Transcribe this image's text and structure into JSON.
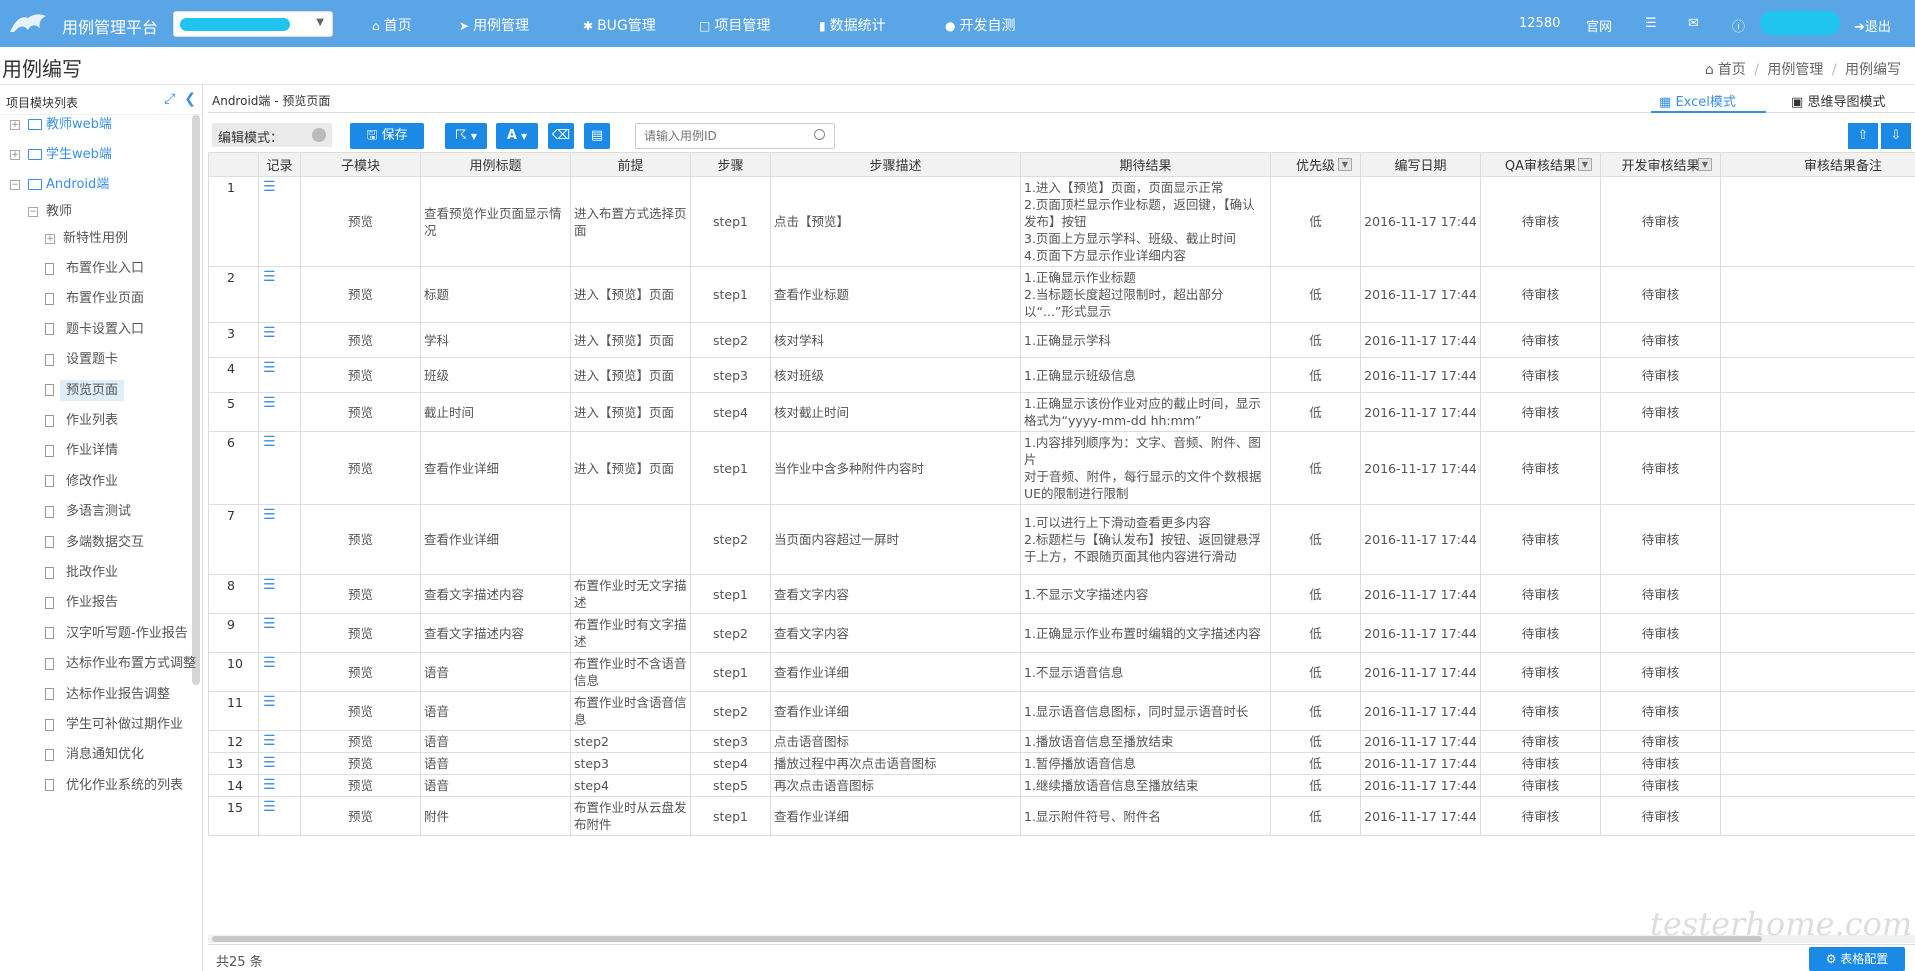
{
  "topnav": {
    "app_title": "用例管理平台",
    "items": [
      {
        "label": "首页",
        "icon": "home-icon"
      },
      {
        "label": "用例管理",
        "icon": "case-icon"
      },
      {
        "label": "BUG管理",
        "icon": "bug-icon"
      },
      {
        "label": "项目管理",
        "icon": "folder-icon"
      },
      {
        "label": "数据统计",
        "icon": "bar-chart-icon"
      },
      {
        "label": "开发自测",
        "icon": "user-icon"
      }
    ],
    "user_id": "12580",
    "official_site": "官网",
    "logout": "退出"
  },
  "page": {
    "title": "用例编写"
  },
  "breadcrumb": {
    "home": "首页",
    "level1": "用例管理",
    "level2": "用例编写",
    "sep": "/"
  },
  "sidebar": {
    "header": "项目模块列表",
    "items": [
      {
        "label": "教师web端",
        "kind": "folder"
      },
      {
        "label": "学生web端",
        "kind": "folder"
      },
      {
        "label": "Android端",
        "kind": "folder"
      },
      {
        "label": "教师",
        "kind": "group"
      },
      {
        "label": "新特性用例",
        "kind": "node"
      },
      {
        "label": "布置作业入口",
        "kind": "page"
      },
      {
        "label": "布置作业页面",
        "kind": "page"
      },
      {
        "label": "题卡设置入口",
        "kind": "page"
      },
      {
        "label": "设置题卡",
        "kind": "page"
      },
      {
        "label": "预览页面",
        "kind": "page",
        "selected": true
      },
      {
        "label": "作业列表",
        "kind": "page"
      },
      {
        "label": "作业详情",
        "kind": "page"
      },
      {
        "label": "修改作业",
        "kind": "page"
      },
      {
        "label": "多语言测试",
        "kind": "page"
      },
      {
        "label": "多端数据交互",
        "kind": "page"
      },
      {
        "label": "批改作业",
        "kind": "page"
      },
      {
        "label": "作业报告",
        "kind": "page"
      },
      {
        "label": "汉字听写题-作业报告",
        "kind": "page"
      },
      {
        "label": "达标作业布置方式调整",
        "kind": "page"
      },
      {
        "label": "达标作业报告调整",
        "kind": "page"
      },
      {
        "label": "学生可补做过期作业",
        "kind": "page"
      },
      {
        "label": "消息通知优化",
        "kind": "page"
      },
      {
        "label": "优化作业系统的列表",
        "kind": "page"
      }
    ]
  },
  "content": {
    "module_path": "Android端 - 预览页面",
    "tab_excel": "Excel模式",
    "tab_mind": "思维导图模式",
    "edit_mode_label": "编辑模式：",
    "save_label": "保存",
    "search_placeholder": "请输入用例ID",
    "total": "共25 条",
    "table_config": "表格配置",
    "watermark": "testerhome.com"
  },
  "table": {
    "headers": [
      "",
      "记录",
      "子模块",
      "用例标题",
      "前提",
      "步骤",
      "步骤描述",
      "期待结果",
      "优先级",
      "编写日期",
      "QA审核结果",
      "开发审核结果",
      "审核结果备注"
    ],
    "rows": [
      {
        "no": "1",
        "module": "预览",
        "title": "查看预览作业页面显示情况",
        "pre": "进入布置方式选择页面",
        "step": "step1",
        "desc": "点击【预览】",
        "expect": "1.进入【预览】页面，页面显示正常\n2.页面顶栏显示作业标题，返回键，【确认发布】按钮\n3.页面上方显示学科、班级、截止时间\n4.页面下方显示作业详细内容",
        "prio": "低",
        "date": "2016-11-17 17:44",
        "qa": "待审核",
        "dev": "待审核",
        "note": ""
      },
      {
        "no": "2",
        "module": "预览",
        "title": "标题",
        "pre": "进入【预览】页面",
        "step": "step1",
        "desc": "查看作业标题",
        "expect": "1.正确显示作业标题\n2.当标题长度超过限制时，超出部分以“...”形式显示",
        "prio": "低",
        "date": "2016-11-17 17:44",
        "qa": "待审核",
        "dev": "待审核",
        "note": ""
      },
      {
        "no": "3",
        "module": "预览",
        "title": "学科",
        "pre": "进入【预览】页面",
        "step": "step2",
        "desc": "核对学科",
        "expect": "1.正确显示学科",
        "prio": "低",
        "date": "2016-11-17 17:44",
        "qa": "待审核",
        "dev": "待审核",
        "note": ""
      },
      {
        "no": "4",
        "module": "预览",
        "title": "班级",
        "pre": "进入【预览】页面",
        "step": "step3",
        "desc": "核对班级",
        "expect": "1.正确显示班级信息",
        "prio": "低",
        "date": "2016-11-17 17:44",
        "qa": "待审核",
        "dev": "待审核",
        "note": ""
      },
      {
        "no": "5",
        "module": "预览",
        "title": "截止时间",
        "pre": "进入【预览】页面",
        "step": "step4",
        "desc": "核对截止时间",
        "expect": "1.正确显示该份作业对应的截止时间，显示格式为“yyyy-mm-dd hh:mm”",
        "prio": "低",
        "date": "2016-11-17 17:44",
        "qa": "待审核",
        "dev": "待审核",
        "note": ""
      },
      {
        "no": "6",
        "module": "预览",
        "title": "查看作业详细",
        "pre": "进入【预览】页面",
        "step": "step1",
        "desc": "当作业中含多种附件内容时",
        "expect": "1.内容排列顺序为：文字、音频、附件、图片\n对于音频、附件，每行显示的文件个数根据UE的限制进行限制",
        "prio": "低",
        "date": "2016-11-17 17:44",
        "qa": "待审核",
        "dev": "待审核",
        "note": ""
      },
      {
        "no": "7",
        "module": "预览",
        "title": "查看作业详细",
        "pre": "",
        "step": "step2",
        "desc": "当页面内容超过一屏时",
        "expect": "1.可以进行上下滑动查看更多内容\n2.标题栏与【确认发布】按钮、返回键悬浮于上方，不跟随页面其他内容进行滑动",
        "prio": "低",
        "date": "2016-11-17 17:44",
        "qa": "待审核",
        "dev": "待审核",
        "note": ""
      },
      {
        "no": "8",
        "module": "预览",
        "title": "查看文字描述内容",
        "pre": "布置作业时无文字描述",
        "step": "step1",
        "desc": "查看文字内容",
        "expect": "1.不显示文字描述内容",
        "prio": "低",
        "date": "2016-11-17 17:44",
        "qa": "待审核",
        "dev": "待审核",
        "note": ""
      },
      {
        "no": "9",
        "module": "预览",
        "title": "查看文字描述内容",
        "pre": "布置作业时有文字描述",
        "step": "step2",
        "desc": "查看文字内容",
        "expect": "1.正确显示作业布置时编辑的文字描述内容",
        "prio": "低",
        "date": "2016-11-17 17:44",
        "qa": "待审核",
        "dev": "待审核",
        "note": ""
      },
      {
        "no": "10",
        "module": "预览",
        "title": "语音",
        "pre": "布置作业时不含语音信息",
        "step": "step1",
        "desc": "查看作业详细",
        "expect": "1.不显示语音信息",
        "prio": "低",
        "date": "2016-11-17 17:44",
        "qa": "待审核",
        "dev": "待审核",
        "note": ""
      },
      {
        "no": "11",
        "module": "预览",
        "title": "语音",
        "pre": "布置作业时含语音信息",
        "step": "step2",
        "desc": "查看作业详细",
        "expect": "1.显示语音信息图标，同时显示语音时长",
        "prio": "低",
        "date": "2016-11-17 17:44",
        "qa": "待审核",
        "dev": "待审核",
        "note": ""
      },
      {
        "no": "12",
        "module": "预览",
        "title": "语音",
        "pre": "step2",
        "step": "step3",
        "desc": "点击语音图标",
        "expect": "1.播放语音信息至播放结束",
        "prio": "低",
        "date": "2016-11-17 17:44",
        "qa": "待审核",
        "dev": "待审核",
        "note": ""
      },
      {
        "no": "13",
        "module": "预览",
        "title": "语音",
        "pre": "step3",
        "step": "step4",
        "desc": "播放过程中再次点击语音图标",
        "expect": "1.暂停播放语音信息",
        "prio": "低",
        "date": "2016-11-17 17:44",
        "qa": "待审核",
        "dev": "待审核",
        "note": ""
      },
      {
        "no": "14",
        "module": "预览",
        "title": "语音",
        "pre": "step4",
        "step": "step5",
        "desc": "再次点击语音图标",
        "expect": "1.继续播放语音信息至播放结束",
        "prio": "低",
        "date": "2016-11-17 17:44",
        "qa": "待审核",
        "dev": "待审核",
        "note": ""
      },
      {
        "no": "15",
        "module": "预览",
        "title": "附件",
        "pre": "布置作业时从云盘发布附件",
        "step": "step1",
        "desc": "查看作业详细",
        "expect": "1.显示附件符号、附件名",
        "prio": "低",
        "date": "2016-11-17 17:44",
        "qa": "待审核",
        "dev": "待审核",
        "note": ""
      }
    ]
  }
}
